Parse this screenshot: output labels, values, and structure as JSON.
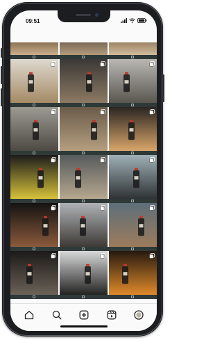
{
  "status_bar": {
    "time": "09:51",
    "icons": [
      "signal-icon",
      "wifi-icon",
      "battery-icon"
    ]
  },
  "grid": {
    "rows": [
      {
        "cells": [
          {
            "name": "post-wood-block",
            "colors": [
              "#8a7355",
              "#cdb08d"
            ],
            "badge": false
          },
          {
            "name": "post-workbench",
            "colors": [
              "#7b6a57",
              "#b49b7c"
            ],
            "badge": false
          },
          {
            "name": "post-tabletop",
            "colors": [
              "#9e8467",
              "#d2bd9c"
            ],
            "badge": false
          }
        ]
      },
      {
        "cells": [
          {
            "name": "post-green-box",
            "colors": [
              "#ded9cf",
              "#a58a65"
            ],
            "badge": true
          },
          {
            "name": "post-hands-can",
            "colors": [
              "#3b3936",
              "#8c7a64"
            ],
            "badge": true
          },
          {
            "name": "post-sink-can",
            "colors": [
              "#b9b7b2",
              "#5a5650"
            ],
            "badge": true
          }
        ]
      },
      {
        "cells": [
          {
            "name": "post-green-box-2",
            "colors": [
              "#9c9a92",
              "#4d4a43"
            ],
            "badge": true
          },
          {
            "name": "post-cans-table",
            "colors": [
              "#6b5c4a",
              "#b59e7f"
            ],
            "badge": true
          },
          {
            "name": "post-can-closeup",
            "colors": [
              "#2b2622",
              "#d9a56a"
            ],
            "badge": true
          }
        ]
      },
      {
        "cells": [
          {
            "name": "post-shelf-bottles",
            "colors": [
              "#1d1c1c",
              "#d6c23a"
            ],
            "badge": true
          },
          {
            "name": "post-spray-panel",
            "colors": [
              "#565b5c",
              "#b6a78f"
            ],
            "badge": true
          },
          {
            "name": "post-black-panel",
            "colors": [
              "#9fb0b6",
              "#2f3234"
            ],
            "badge": true
          }
        ]
      },
      {
        "cells": [
          {
            "name": "post-hand-can-dark",
            "colors": [
              "#141312",
              "#8b5a3c"
            ],
            "badge": true
          },
          {
            "name": "post-man-table",
            "colors": [
              "#aeb2b5",
              "#3e3a36"
            ],
            "badge": true
          },
          {
            "name": "post-cans-room",
            "colors": [
              "#5d6f7a",
              "#9c7b5c"
            ],
            "badge": true
          }
        ]
      },
      {
        "cells": [
          {
            "name": "post-hand-spray",
            "colors": [
              "#1b1a19",
              "#6c6257"
            ],
            "badge": true
          },
          {
            "name": "post-black-table",
            "colors": [
              "#d7d8d8",
              "#232322"
            ],
            "badge": true
          },
          {
            "name": "post-pumpkins",
            "colors": [
              "#261a10",
              "#e08a2a"
            ],
            "badge": true
          }
        ]
      }
    ]
  },
  "tab_bar": {
    "items": [
      {
        "name": "home-icon"
      },
      {
        "name": "search-icon"
      },
      {
        "name": "add-post-icon"
      },
      {
        "name": "reels-icon"
      },
      {
        "name": "profile-icon"
      }
    ]
  }
}
